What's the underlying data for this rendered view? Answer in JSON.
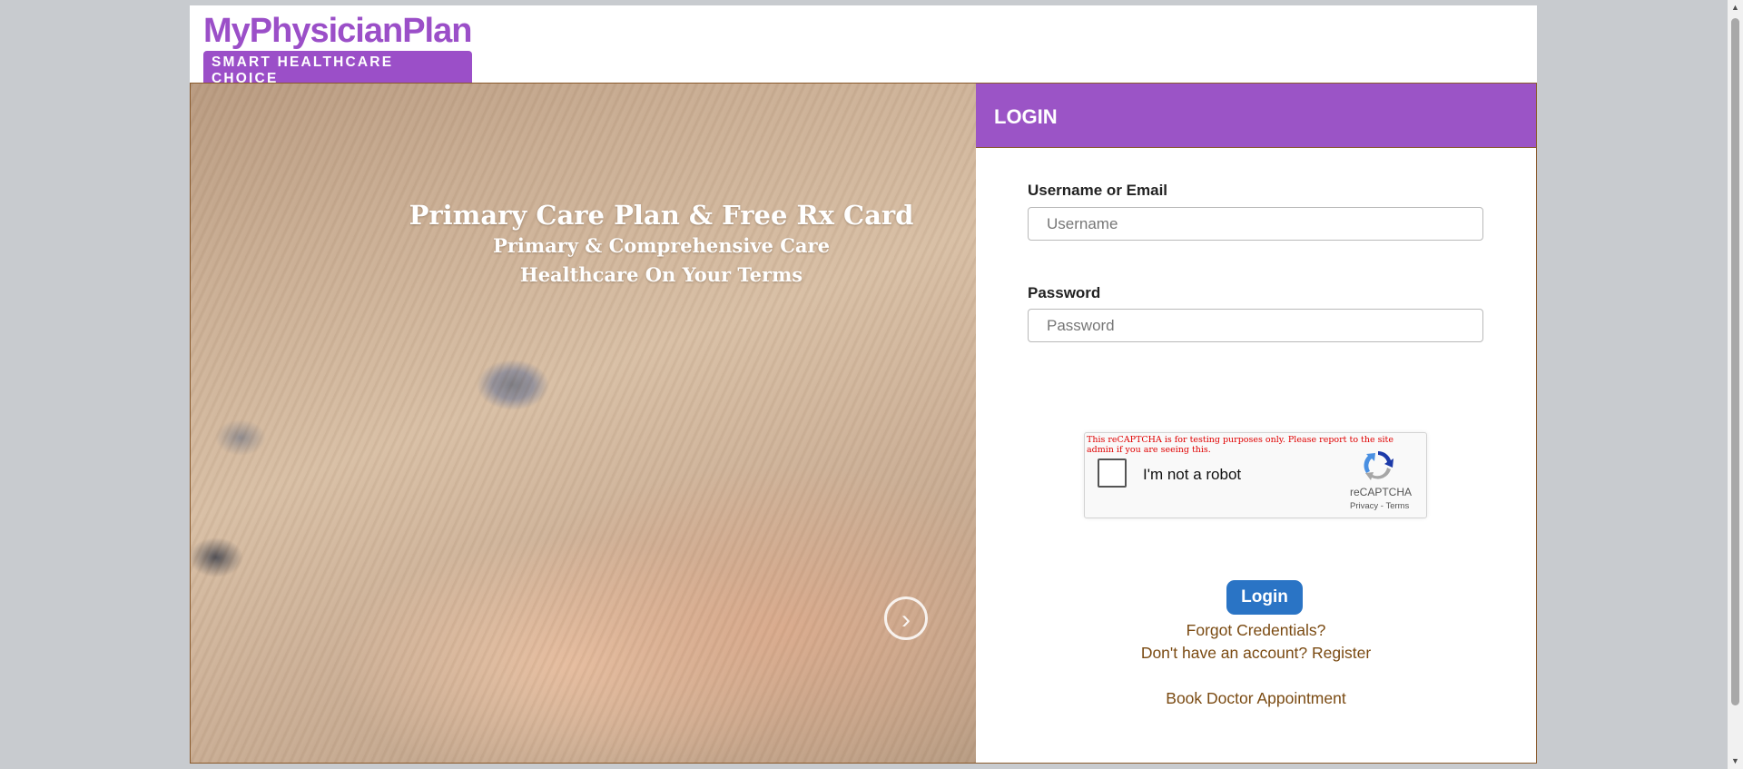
{
  "brand": {
    "name": "MyPhysicianPlan",
    "tagline": "SMART HEALTHCARE CHOICE",
    "color": "#9b4fc8"
  },
  "hero": {
    "line1": "Primary Care Plan & Free Rx Card",
    "line2": "Primary & Comprehensive Care",
    "line3": "Healthcare On Your Terms",
    "next_icon": "chevron-right-icon"
  },
  "login": {
    "title": "LOGIN",
    "header_color": "#9b54c6",
    "username_label": "Username or Email",
    "username_placeholder": "Username",
    "username_value": "",
    "password_label": "Password",
    "password_placeholder": "Password",
    "password_value": "",
    "button_label": "Login",
    "button_color": "#2a74c5",
    "links": {
      "forgot": "Forgot Credentials?",
      "register": "Don't have an account? Register",
      "book": "Book Doctor Appointment"
    }
  },
  "captcha": {
    "warning": "This reCAPTCHA is for testing purposes only. Please report to the site admin if you are seeing this.",
    "label": "I'm not a robot",
    "brand": "reCAPTCHA",
    "privacy": "Privacy",
    "separator": " - ",
    "terms": "Terms"
  }
}
